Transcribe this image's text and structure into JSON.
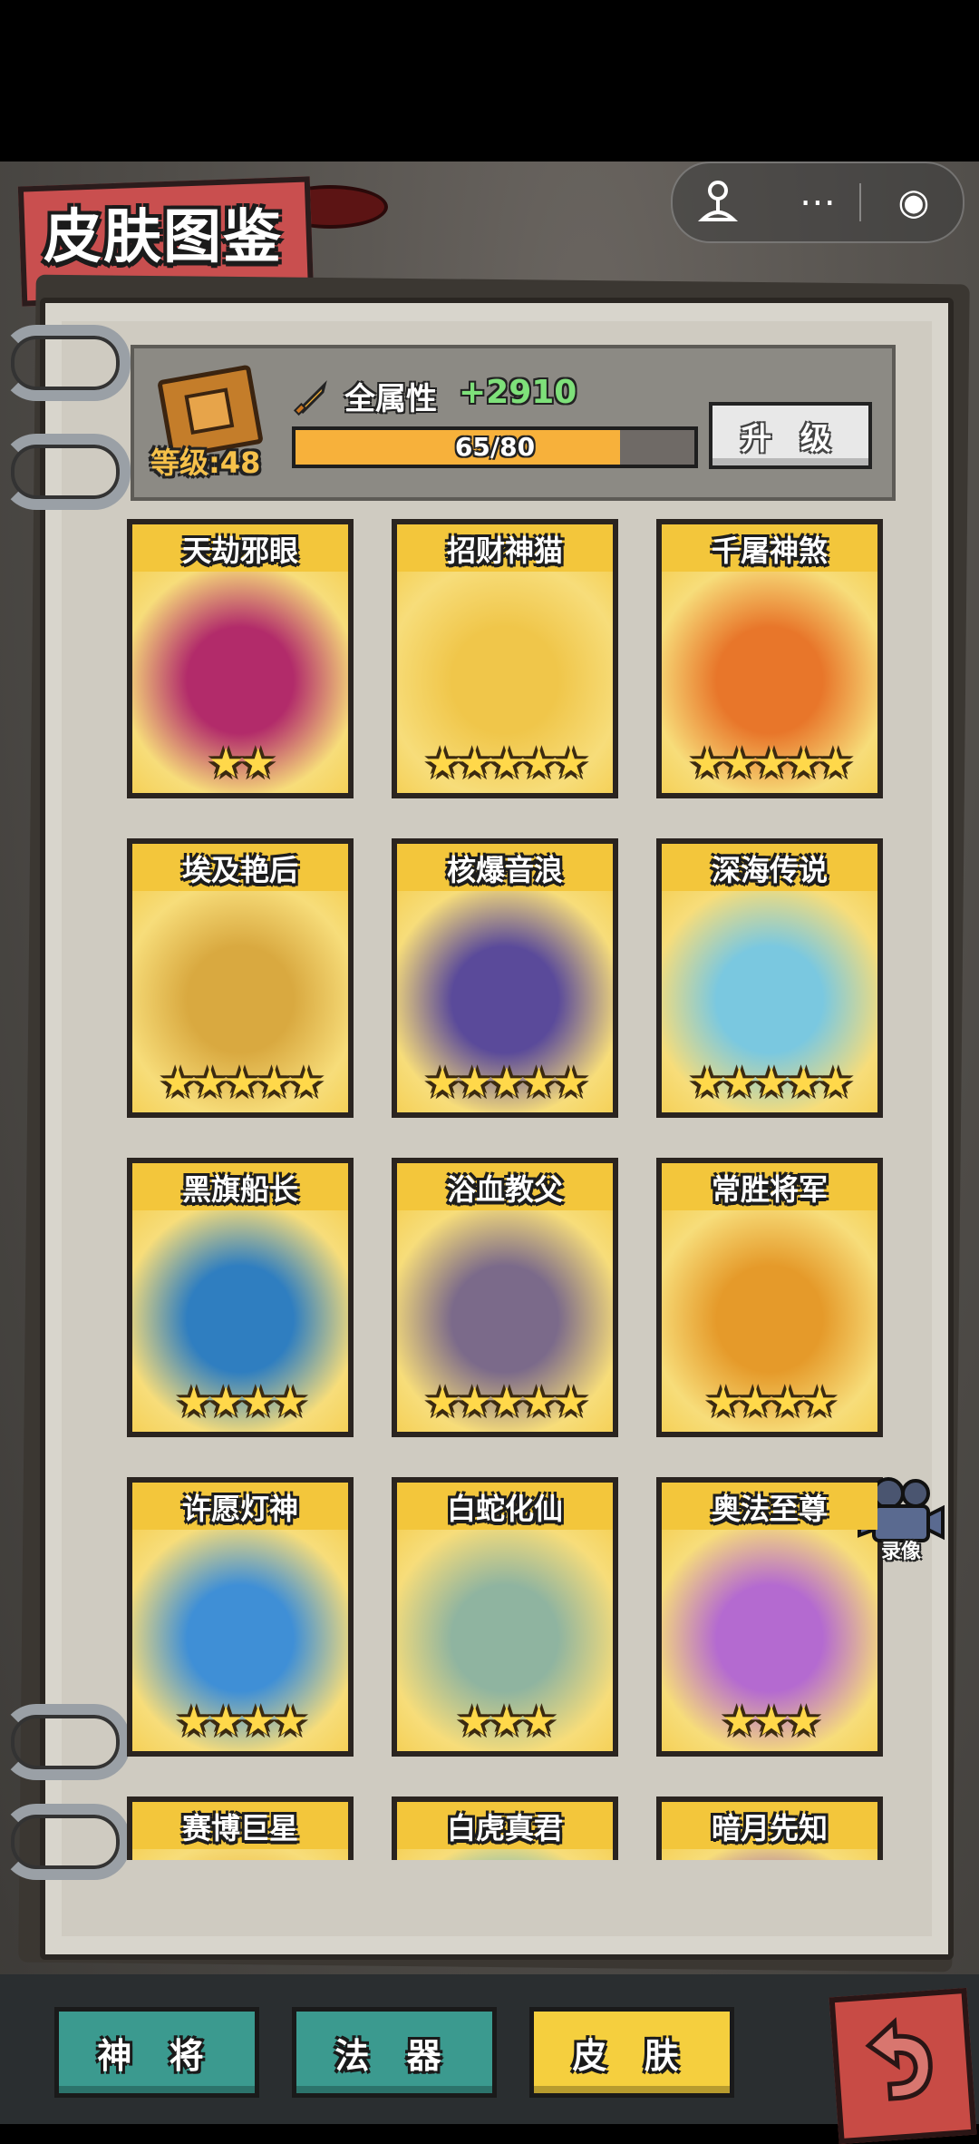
{
  "title": "皮肤图鉴",
  "capsule": {
    "more_icon": "⋯",
    "close_icon": "◉"
  },
  "info": {
    "level_label": "等级:48",
    "attr_label": "全属性",
    "attr_value": "+2910",
    "progress_text": "65/80",
    "progress_value": 65,
    "progress_max": 80,
    "upgrade_label": "升 级"
  },
  "video_label": "录像",
  "tabs": [
    {
      "label": "神 将",
      "active": false
    },
    {
      "label": "法 器",
      "active": false
    },
    {
      "label": "皮 肤",
      "active": true
    }
  ],
  "skins": [
    {
      "name": "天劫邪眼",
      "stars": "★★",
      "color": "#b22b6a"
    },
    {
      "name": "招财神猫",
      "stars": "★★★★★",
      "color": "#f0c64a"
    },
    {
      "name": "千屠神煞",
      "stars": "★★★★★",
      "color": "#e8762a"
    },
    {
      "name": "埃及艳后",
      "stars": "★★★★★",
      "color": "#d9a940"
    },
    {
      "name": "核爆音浪",
      "stars": "★★★★★",
      "color": "#5a4a9a"
    },
    {
      "name": "深海传说",
      "stars": "★★★★★",
      "color": "#7ac8e0"
    },
    {
      "name": "黑旗船长",
      "stars": "★★★★",
      "color": "#2f7ec0"
    },
    {
      "name": "浴血教父",
      "stars": "★★★★★",
      "color": "#7b6a8a"
    },
    {
      "name": "常胜将军",
      "stars": "★★★★",
      "color": "#e59a2a"
    },
    {
      "name": "许愿灯神",
      "stars": "★★★★",
      "color": "#3f8fd6"
    },
    {
      "name": "白蛇化仙",
      "stars": "★★★",
      "color": "#8fb4a0"
    },
    {
      "name": "奥法至尊",
      "stars": "★★★",
      "color": "#b46ad0"
    },
    {
      "name": "赛博巨星",
      "stars": "",
      "color": "#e8b33a"
    },
    {
      "name": "白虎真君",
      "stars": "",
      "color": "#3aa9d8"
    },
    {
      "name": "暗月先知",
      "stars": "",
      "color": "#7b3fc0"
    }
  ]
}
